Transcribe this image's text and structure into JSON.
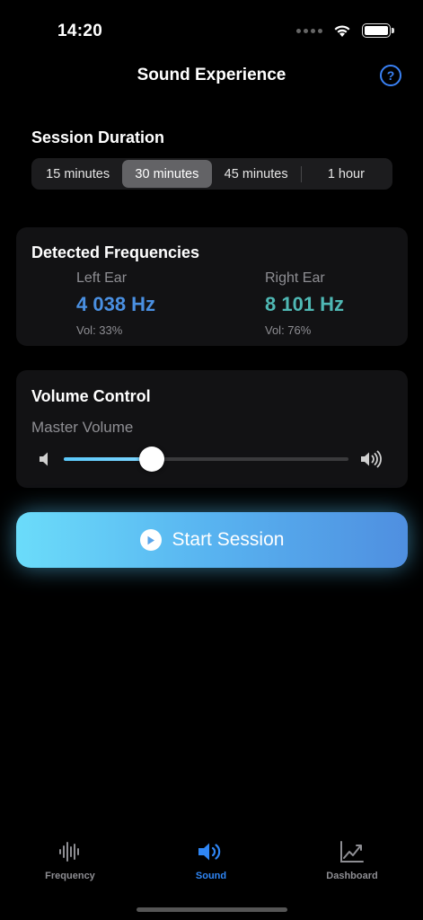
{
  "status_bar": {
    "time": "14:20"
  },
  "header": {
    "title": "Sound Experience",
    "help_label": "?"
  },
  "duration": {
    "title": "Session Duration",
    "options": [
      "15 minutes",
      "30 minutes",
      "45 minutes",
      "1 hour"
    ],
    "selected": "30 minutes"
  },
  "frequencies": {
    "title": "Detected Frequencies",
    "left": {
      "label": "Left Ear",
      "hz": "4 038 Hz",
      "volume": "Vol: 33%",
      "color": "#4a90e2"
    },
    "right": {
      "label": "Right Ear",
      "hz": "8 101 Hz",
      "volume": "Vol: 76%",
      "color": "#4fb8b4"
    }
  },
  "volume": {
    "title": "Volume Control",
    "master_label": "Master Volume",
    "level_percent": 31,
    "low_icon": "speaker-low-icon",
    "high_icon": "speaker-high-icon"
  },
  "start_button": {
    "label": "Start Session",
    "icon": "play-icon"
  },
  "tabs": [
    {
      "label": "Frequency",
      "icon": "waveform-icon",
      "active": false
    },
    {
      "label": "Sound",
      "icon": "speaker-wave-icon",
      "active": true
    },
    {
      "label": "Dashboard",
      "icon": "chart-line-icon",
      "active": false
    }
  ],
  "colors": {
    "accent": "#2f86f5",
    "start_gradient_left": "#6bdcfa",
    "start_gradient_right": "#4f8fe0"
  }
}
